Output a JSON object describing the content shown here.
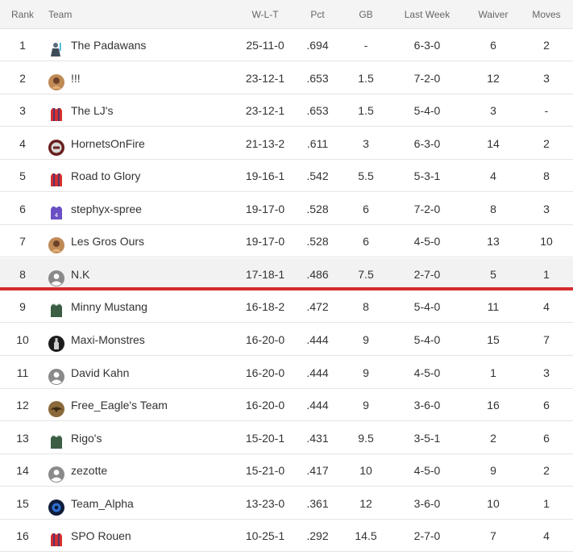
{
  "headers": {
    "rank": "Rank",
    "team": "Team",
    "wlt": "W-L-T",
    "pct": "Pct",
    "gb": "GB",
    "last_week": "Last Week",
    "waiver": "Waiver",
    "moves": "Moves"
  },
  "colors": {
    "playoff_cutline": "#d52b2b",
    "highlight_row": "#f2f2f2",
    "header_bg": "#f4f4f4"
  },
  "rows": [
    {
      "rank": "1",
      "team": "The Padawans",
      "icon": "padawan-figure-icon",
      "wlt": "25-11-0",
      "pct": ".694",
      "gb": "-",
      "last_week": "6-3-0",
      "waiver": "6",
      "moves": "2"
    },
    {
      "rank": "2",
      "team": "!!!",
      "icon": "player-photo-icon",
      "wlt": "23-12-1",
      "pct": ".653",
      "gb": "1.5",
      "last_week": "7-2-0",
      "waiver": "12",
      "moves": "3"
    },
    {
      "rank": "3",
      "team": "The LJ's",
      "icon": "red-jersey-icon",
      "wlt": "23-12-1",
      "pct": ".653",
      "gb": "1.5",
      "last_week": "5-4-0",
      "waiver": "3",
      "moves": "-"
    },
    {
      "rank": "4",
      "team": "HornetsOnFire",
      "icon": "team-badge-icon",
      "wlt": "21-13-2",
      "pct": ".611",
      "gb": "3",
      "last_week": "6-3-0",
      "waiver": "14",
      "moves": "2"
    },
    {
      "rank": "5",
      "team": "Road to Glory",
      "icon": "red-jersey-icon",
      "wlt": "19-16-1",
      "pct": ".542",
      "gb": "5.5",
      "last_week": "5-3-1",
      "waiver": "4",
      "moves": "8"
    },
    {
      "rank": "6",
      "team": "stephyx-spree",
      "icon": "purple-jersey-icon",
      "wlt": "19-17-0",
      "pct": ".528",
      "gb": "6",
      "last_week": "7-2-0",
      "waiver": "8",
      "moves": "3"
    },
    {
      "rank": "7",
      "team": "Les Gros Ours",
      "icon": "player-photo-icon",
      "wlt": "19-17-0",
      "pct": ".528",
      "gb": "6",
      "last_week": "4-5-0",
      "waiver": "13",
      "moves": "10"
    },
    {
      "rank": "8",
      "team": "N.K",
      "icon": "default-avatar-icon",
      "wlt": "17-18-1",
      "pct": ".486",
      "gb": "7.5",
      "last_week": "2-7-0",
      "waiver": "5",
      "moves": "1"
    },
    {
      "rank": "9",
      "team": "Minny Mustang",
      "icon": "green-jersey-icon",
      "wlt": "16-18-2",
      "pct": ".472",
      "gb": "8",
      "last_week": "5-4-0",
      "waiver": "11",
      "moves": "4"
    },
    {
      "rank": "10",
      "team": "Maxi-Monstres",
      "icon": "dark-bottle-icon",
      "wlt": "16-20-0",
      "pct": ".444",
      "gb": "9",
      "last_week": "5-4-0",
      "waiver": "15",
      "moves": "7"
    },
    {
      "rank": "11",
      "team": "David Kahn",
      "icon": "default-avatar-icon",
      "wlt": "16-20-0",
      "pct": ".444",
      "gb": "9",
      "last_week": "4-5-0",
      "waiver": "1",
      "moves": "3"
    },
    {
      "rank": "12",
      "team": "Free_Eagle's Team",
      "icon": "eagle-icon",
      "wlt": "16-20-0",
      "pct": ".444",
      "gb": "9",
      "last_week": "3-6-0",
      "waiver": "16",
      "moves": "6"
    },
    {
      "rank": "13",
      "team": "Rigo's",
      "icon": "green-jersey-icon",
      "wlt": "15-20-1",
      "pct": ".431",
      "gb": "9.5",
      "last_week": "3-5-1",
      "waiver": "2",
      "moves": "6"
    },
    {
      "rank": "14",
      "team": "zezotte",
      "icon": "default-avatar-icon",
      "wlt": "15-21-0",
      "pct": ".417",
      "gb": "10",
      "last_week": "4-5-0",
      "waiver": "9",
      "moves": "2"
    },
    {
      "rank": "15",
      "team": "Team_Alpha",
      "icon": "blue-badge-icon",
      "wlt": "13-23-0",
      "pct": ".361",
      "gb": "12",
      "last_week": "3-6-0",
      "waiver": "10",
      "moves": "1"
    },
    {
      "rank": "16",
      "team": "SPO Rouen",
      "icon": "red-jersey-icon",
      "wlt": "10-25-1",
      "pct": ".292",
      "gb": "14.5",
      "last_week": "2-7-0",
      "waiver": "7",
      "moves": "4"
    }
  ]
}
